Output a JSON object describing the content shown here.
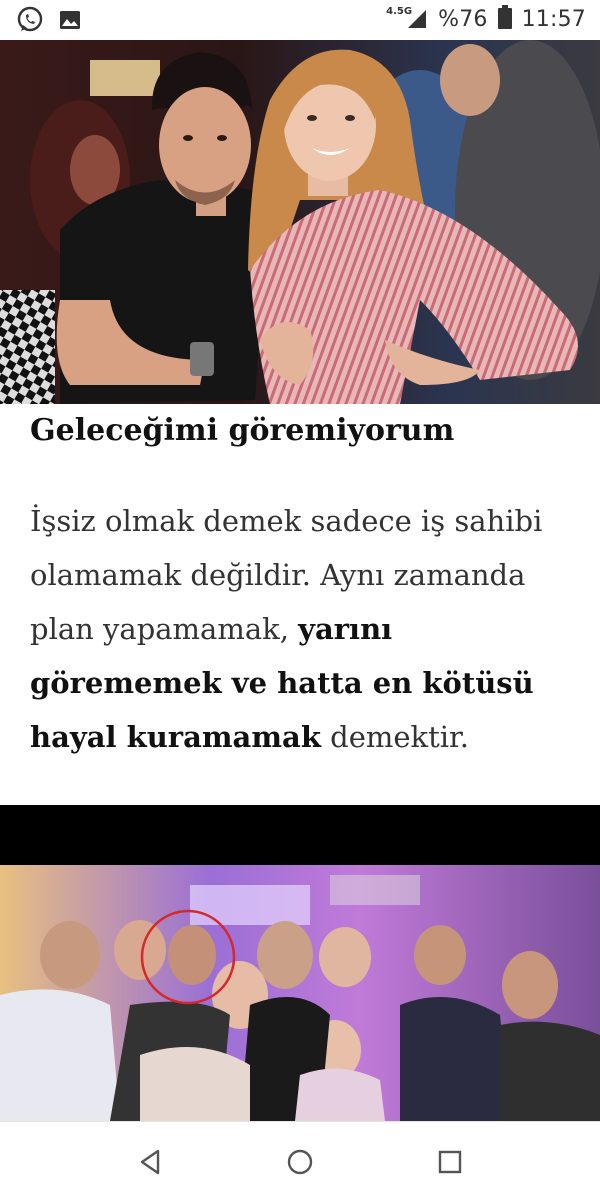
{
  "status_bar": {
    "icons_left": [
      "whatsapp-icon",
      "image-icon"
    ],
    "network": "4.5G",
    "battery_percent": "%76",
    "time": "11:57"
  },
  "article": {
    "heading": "Geleceğimi göremiyorum",
    "paragraph": {
      "part1": "İşsiz olmak demek sadece iş sahibi olamamak değildir. Aynı zamanda plan yapamamak, ",
      "bold1": "yarını görememek ve hatta en kötüsü hayal kuramamak",
      "part2": " demektir."
    }
  },
  "navigation": {
    "buttons": [
      "back-icon",
      "home-icon",
      "recents-icon"
    ]
  },
  "colors": {
    "accent_circle": "#d62828",
    "text": "#333333",
    "heading": "#111111"
  }
}
